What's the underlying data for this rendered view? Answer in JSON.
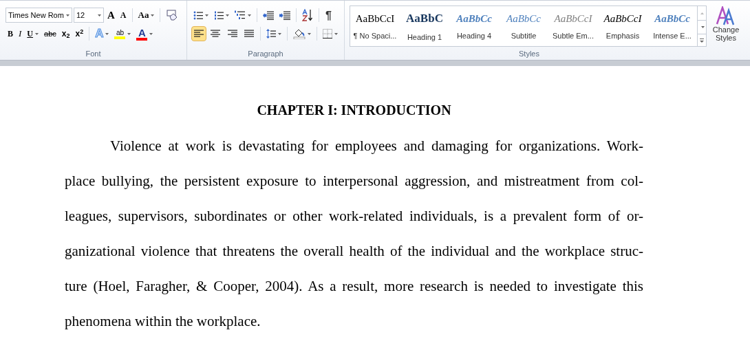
{
  "ribbon": {
    "font": {
      "label": "Font",
      "font_name": "Times New Rom",
      "font_size": "12",
      "row1": [
        {
          "kind": "grow",
          "text": "A"
        },
        {
          "kind": "shrink",
          "text": "A"
        },
        {
          "kind": "case",
          "text": "Aa"
        },
        {
          "kind": "clear"
        }
      ],
      "row2": [
        {
          "kind": "bold",
          "text": "B"
        },
        {
          "kind": "italic",
          "text": "I"
        },
        {
          "kind": "underline",
          "text": "U"
        },
        {
          "kind": "strike",
          "text": "abc"
        },
        {
          "kind": "script",
          "text": "x$_{2}$"
        },
        {
          "kind": "script",
          "text": "x$^{2}$"
        },
        {
          "kind": "effects",
          "text": "A"
        },
        {
          "kind": "highlight",
          "text": "ab",
          "color": "#ffff00"
        },
        {
          "kind": "fontcolor",
          "text": "A",
          "color": "#ff0000"
        }
      ]
    },
    "paragraph": {
      "label": "Paragraph",
      "row1": [
        {
          "kind": "bullets"
        },
        {
          "kind": "numbering"
        },
        {
          "kind": "multilevel"
        },
        {
          "kind": "outdent"
        },
        {
          "kind": "indent"
        },
        {
          "kind": "sort"
        },
        {
          "kind": "pilcrow",
          "text": "¶"
        }
      ],
      "alignments": [
        {
          "kind": "left",
          "selected": true
        },
        {
          "kind": "center",
          "selected": false
        },
        {
          "kind": "right",
          "selected": false
        },
        {
          "kind": "justify",
          "selected": false
        }
      ],
      "row2": [
        {
          "kind": "spacing"
        },
        {
          "kind": "shading"
        },
        {
          "kind": "borders"
        }
      ]
    },
    "styles": {
      "label": "Styles",
      "items": [
        {
          "sample": "AaBbCcI",
          "name": "¶ No Spaci...",
          "kind": "normal"
        },
        {
          "sample": "AaBbC",
          "name": "Heading 1",
          "kind": "heading"
        },
        {
          "sample": "AaBbCc",
          "name": "Heading 4",
          "kind": "heading-italic"
        },
        {
          "sample": "AaBbCc",
          "name": "Subtitle",
          "kind": "subtitle"
        },
        {
          "sample": "AaBbCcI",
          "name": "Subtle Em...",
          "kind": "subtle"
        },
        {
          "sample": "AaBbCcI",
          "name": "Emphasis",
          "kind": "emphasis"
        },
        {
          "sample": "AaBbCc",
          "name": "Intense E...",
          "kind": "intense"
        }
      ],
      "change_styles": "Change Styles"
    }
  },
  "document": {
    "heading": "CHAPTER I: INTRODUCTION",
    "paragraph_lines": [
      "Violence at work is devastating for employees and damaging for organizations. Work-",
      "place bullying, the persistent exposure to interpersonal aggression, and mistreatment from col-",
      "leagues, supervisors, subordinates or other work-related individuals, is a prevalent form of or-",
      "ganizational violence that threatens the overall health of the individual and the workplace struc-",
      "ture (Hoel, Faragher, & Cooper, 2004). As a result, more research is needed to investigate this",
      "phenomena within the workplace."
    ]
  }
}
